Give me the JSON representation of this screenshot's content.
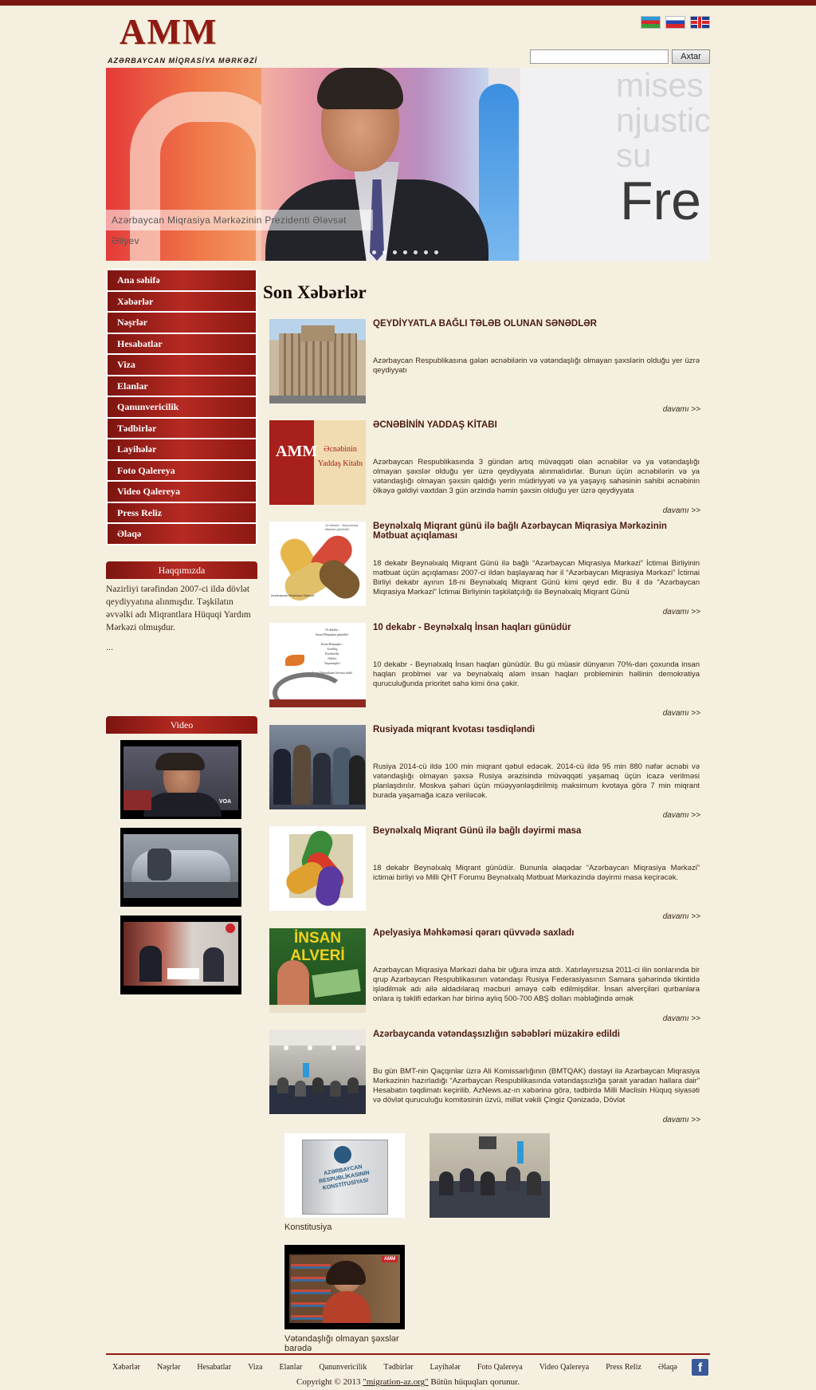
{
  "header": {
    "logo": "AMM",
    "logo_subtitle": "AZƏRBAYCAN MİQRASİYA MƏRKƏZİ",
    "languages": [
      "Azərbaycan",
      "Русский",
      "English"
    ],
    "search": {
      "placeholder": "",
      "button": "Axtar"
    }
  },
  "banner": {
    "caption": "Azərbaycan Miqrasiya Mərkəzinin Prezidenti Ələvsət Əliyev",
    "ghost_text": "mises c\nnjustic\nsu",
    "big_text": "Fre"
  },
  "sidebar": {
    "nav": [
      "Ana səhifə",
      "Xəbərlər",
      "Nəşrlər",
      "Hesabatlar",
      "Viza",
      "Elanlar",
      "Qanunvericilik",
      "Tədbirlər",
      "Layihələr",
      "Foto Qalereya",
      "Video Qalereya",
      "Press Reliz",
      "Əlaqə"
    ],
    "about": {
      "title": "Haqqımızda",
      "text": "Nazirliyi tərəfindən 2007-ci ildə dövlət qeydiyyatına alınmışdır. Təşkilatın əvvəlki adı Miqrantlara Hüquqi Yardım Mərkəzi olmuşdur.",
      "more": "..."
    },
    "video": {
      "title": "Video"
    }
  },
  "main": {
    "title": "Son Xəbərlər",
    "more_label": "davamı >>",
    "news": [
      {
        "title": "QEYDİYYATLA BAĞLI TƏLƏB OLUNAN SƏNƏDLƏR",
        "text": "Azərbaycan Respublikasına gələn əcnəbilərin və vətəndaşlığı olmayan şəxslərin olduğu yer üzrə qeydiyyatı"
      },
      {
        "title": "ƏCNƏBİNİN YADDAŞ KİTABI",
        "text": "Azərbaycan Respublikasında 3 gündən artıq müvəqqəti olan əcnəbilər və ya vətəndaşlığı olmayan şəxslər olduğu yer üzrə qeydiyyata alınmalıdırlar. Bunun üçün əcnəbilərin və ya vətəndaşlığı olmayan şəxsin qaldığı yerin müdiriyyəti və ya yaşayış sahəsinin sahibi əcnəbinin ölkəyə gəldiyi vaxtdan 3 gün ərzində həmin şəxsin olduğu yer üzrə qeydiyyata"
      },
      {
        "title": "Beynəlxalq Miqrant günü ilə bağlı Azərbaycan Miqrasiya Mərkəzinin Mətbuat açıqlaması",
        "text": "18 dekabr Beynəlxalq Miqrant Günü ilə bağlı “Azərbaycan Miqrasiya Mərkəzi” İctimai Birliyinin mətbuat üçün açıqlaması 2007-ci ildən başlayaraq hər il “Azərbaycan Miqrasiya Mərkəzi” İctimai Birliyi dekabr ayının 18-ni Beynəlxalq Miqrant Günü kimi qeyd edir. Bu il də “Azərbaycan Miqrasiya Mərkəzi” İctimai Birliyinin təşkilatçılığı ilə Beynəlxalq Miqrant Günü"
      },
      {
        "title": "10 dekabr - Beynəlxalq İnsan haqları günüdür",
        "text": "10 dekabr - Beynəlxalq İnsan haqları günüdür. Bu gü müasir dünyanın 70%-dən çoxunda insan haqları problmei var və beynəlxalq aləm insan haqları probleminin həllinin demokratiya quruculuğunda prioritet sahə kimi önə çəkir."
      },
      {
        "title": "Rusiyada miqrant kvotası təsdiqləndi",
        "text": "Rusiya 2014-cü ildə 100 min miqrant qəbul edəcək. 2014-cü ildə 95 min 880 nəfər əcnəbi və vətəndaşlığı olmayan şəxsə Rusiya ərazisində müvəqqəti yaşamaq üçün icazə verilməsi planlaşdırılır. Moskva şəhəri üçün müəyyənləşdirilmiş maksimum kvotaya görə 7 min miqrant burada yaşamağa icazə veriləcək."
      },
      {
        "title": "Beynəlxalq Miqrant Günü ilə bağlı dəyirmi masa",
        "text": "18 dekabr  Beynəlxalq Miqrant günüdür. Bununla əlaqədar “Azərbaycan Miqrasiya Mərkəzi” ictimai birliyi  və Milli QHT Forumu Beynəlxalq Mətbuat Mərkəzində dəyirmi masa keçirəcək."
      },
      {
        "title": "Apelyasiya Məhkəməsi qərarı qüvvədə saxladı",
        "text": "Azərbaycan Miqrasiya Mərkəzi daha bir uğura imza atdı. Xatırlayırsızsa 2011-ci ilin sonlarında bir qrup Azərbaycan Respublikasının vətəndaşı Rusiya Federasiyasının Samara şəhərində tikintidə işlədilmək adı ailə aldadılaraq məcburi əməyə cəlb edilmişdilər. İnsan alverçiləri qurbanlara onlara iş təklifi edərkən hər birinə aylıq 500-700 ABŞ dolları məbləğində əmək"
      },
      {
        "title": "Azərbaycanda vətəndaşsızlığın səbəbləri müzakirə edildi",
        "text": "Bu gün BMT-nin Qaçqınlar üzrə Ali Komissarlığının (BMTQAK) dəstəyi ilə Azərbaycan Miqrasiya Mərkəzinin hazırladığı “Azərbaycan Respublikasında vətəndaşsızlığa şərait yaradan hallara dair” Hesabatın təqdimatı keçirilib. AzNews.az-ın xəbərinə görə, tədbirdə Milli Məclisin Hüquq siyasəti və dövlət quruculuğu komitəsinin üzvü, millət vəkili Çingiz Qənizadə, Dövlət"
      }
    ],
    "news_images": {
      "n1_label": "",
      "n2_label": "AMM",
      "n2_side": "Əcnəbinin Yaddaş Kitabı",
      "n3_small": "18 dekabr - Beynəlxalq Miqrant günüdür!",
      "n3_bottom": "Azərbaycan Miqrasiya Mərkəzi",
      "n4_lines": "10 dekabr -\nİnsan Hüquqları günüdür!\n\nİnsan Hüquqları -\nAzadlıq,\nBərabərlik,\nƏdalət,\nYaşamaqdır!\n\nİnsan Hüquqlarını hörmət edək!",
      "n7_label": "İNSAN ALVERİ"
    },
    "bottom_cards": [
      {
        "caption": "Konstitusiya",
        "book_text": "AZƏRBAYCAN RESPUBLİKASININ KONSTİTUSİYASI"
      },
      {
        "caption": ""
      },
      {
        "caption": "Vətəndaşlığı olmayan şəxslər barədə",
        "badge": "AMM"
      }
    ]
  },
  "footer": {
    "nav": [
      "Xəbərlər",
      "Nəşrlər",
      "Hesabatlar",
      "Viza",
      "Elanlar",
      "Qanunvericilik",
      "Tədbirlər",
      "Layihələr",
      "Foto Qalereya",
      "Video Qalereya",
      "Press Reliz",
      "Əlaqə"
    ],
    "facebook": "f",
    "copyright_prefix": "Copyright © 2013",
    "copyright_link": "\"migration-az.org\"",
    "copyright_suffix": "Bütün hüquqları qorunur."
  }
}
